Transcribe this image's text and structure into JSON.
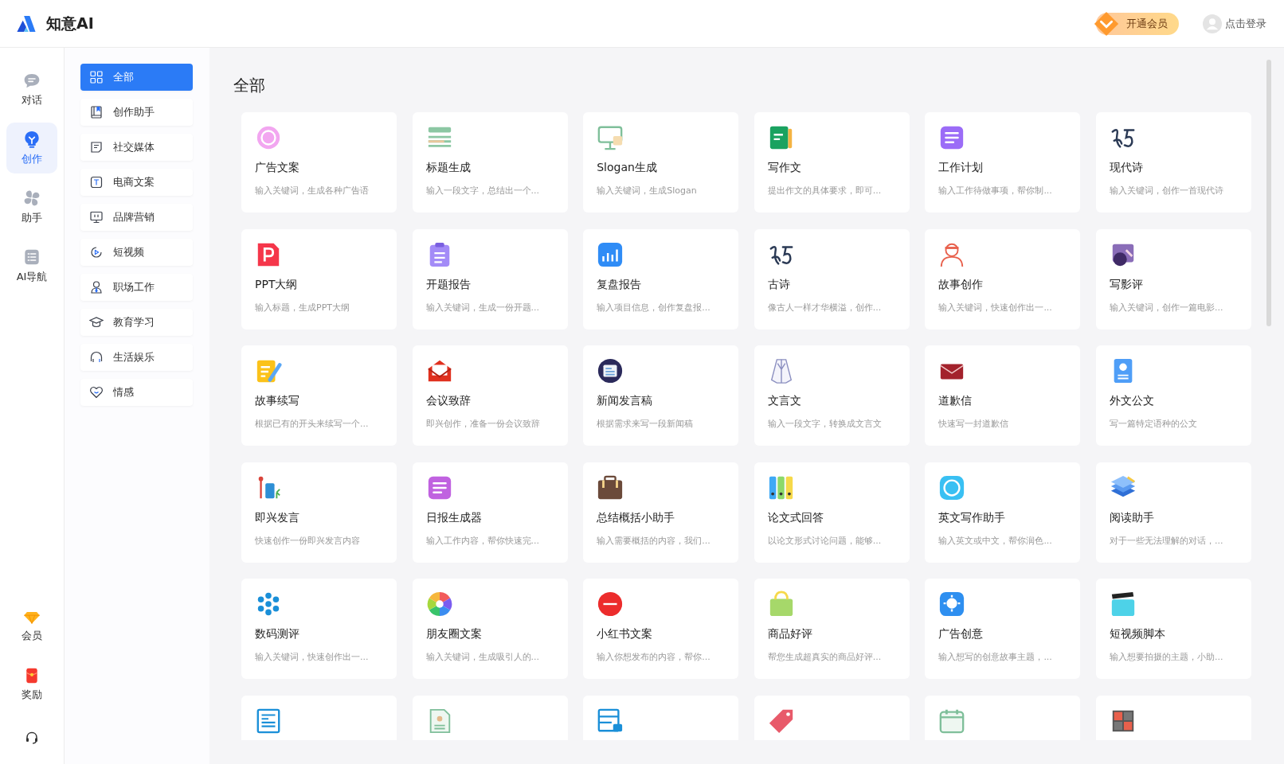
{
  "app": {
    "name": "知意AI"
  },
  "header": {
    "vip_button": "开通会员",
    "login": "点击登录"
  },
  "rail": {
    "items": [
      {
        "label": "对话",
        "selected": false
      },
      {
        "label": "创作",
        "selected": true
      },
      {
        "label": "助手",
        "selected": false
      },
      {
        "label": "AI导航",
        "selected": false
      }
    ],
    "bottom_items": [
      {
        "label": "会员"
      },
      {
        "label": "奖励"
      }
    ]
  },
  "categories": [
    {
      "label": "全部",
      "selected": true
    },
    {
      "label": "创作助手",
      "selected": false
    },
    {
      "label": "社交媒体",
      "selected": false
    },
    {
      "label": "电商文案",
      "selected": false
    },
    {
      "label": "品牌营销",
      "selected": false
    },
    {
      "label": "短视频",
      "selected": false
    },
    {
      "label": "职场工作",
      "selected": false
    },
    {
      "label": "教育学习",
      "selected": false
    },
    {
      "label": "生活娱乐",
      "selected": false
    },
    {
      "label": "情感",
      "selected": false
    }
  ],
  "section_title": "全部",
  "cards": [
    {
      "title": "广告文案",
      "description": "输入关键词，生成各种广告语"
    },
    {
      "title": "标题生成",
      "description": "输入一段文字，总结出一个..."
    },
    {
      "title": "Slogan生成",
      "description": "输入关键词，生成Slogan"
    },
    {
      "title": "写作文",
      "description": "提出作文的具体要求，即可..."
    },
    {
      "title": "工作计划",
      "description": "输入工作待做事项，帮你制..."
    },
    {
      "title": "现代诗",
      "description": "输入关键词，创作一首现代诗"
    },
    {
      "title": "PPT大纲",
      "description": "输入标题，生成PPT大纲"
    },
    {
      "title": "开题报告",
      "description": "输入关键词，生成一份开题..."
    },
    {
      "title": "复盘报告",
      "description": "输入项目信息，创作复盘报..."
    },
    {
      "title": "古诗",
      "description": "像古人一样才华横溢，创作..."
    },
    {
      "title": "故事创作",
      "description": "输入关键词，快速创作出一..."
    },
    {
      "title": "写影评",
      "description": "输入关键词，创作一篇电影..."
    },
    {
      "title": "故事续写",
      "description": "根据已有的开头来续写一个..."
    },
    {
      "title": "会议致辞",
      "description": "即兴创作，准备一份会议致辞"
    },
    {
      "title": "新闻发言稿",
      "description": "根据需求来写一段新闻稿"
    },
    {
      "title": "文言文",
      "description": "输入一段文字，转换成文言文"
    },
    {
      "title": "道歉信",
      "description": "快速写一封道歉信"
    },
    {
      "title": "外文公文",
      "description": "写一篇特定语种的公文"
    },
    {
      "title": "即兴发言",
      "description": "快速创作一份即兴发言内容"
    },
    {
      "title": "日报生成器",
      "description": "输入工作内容，帮你快速完..."
    },
    {
      "title": "总结概括小助手",
      "description": "输入需要概括的内容，我们..."
    },
    {
      "title": "论文式回答",
      "description": "以论文形式讨论问题，能够..."
    },
    {
      "title": "英文写作助手",
      "description": "输入英文或中文，帮你润色..."
    },
    {
      "title": "阅读助手",
      "description": "对于一些无法理解的对话，..."
    },
    {
      "title": "数码测评",
      "description": "输入关键词，快速创作出一..."
    },
    {
      "title": "朋友圈文案",
      "description": "输入关键词，生成吸引人的..."
    },
    {
      "title": "小红书文案",
      "description": "输入你想发布的内容，帮你..."
    },
    {
      "title": "商品好评",
      "description": "帮您生成超真实的商品好评..."
    },
    {
      "title": "广告创意",
      "description": "输入想写的创意故事主题，..."
    },
    {
      "title": "短视频脚本",
      "description": "输入想要拍摄的主题，小助..."
    },
    {
      "kind": "cut_off"
    },
    {
      "kind": "cut_off"
    },
    {
      "kind": "cut_off"
    },
    {
      "kind": "cut_off"
    },
    {
      "kind": "cut_off"
    },
    {
      "kind": "cut_off"
    }
  ]
}
